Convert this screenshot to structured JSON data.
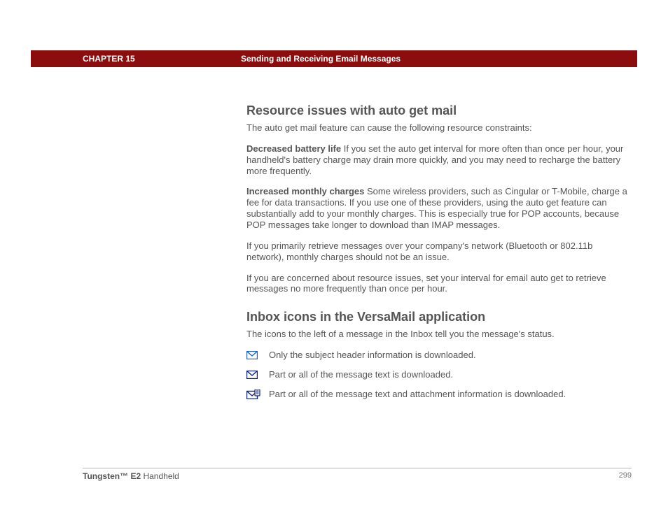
{
  "header": {
    "chapter": "CHAPTER 15",
    "title": "Sending and Receiving Email Messages"
  },
  "section1": {
    "heading": "Resource issues with auto get mail",
    "intro": "The auto get mail feature can cause the following resource constraints:",
    "p1_bold": "Decreased battery life",
    "p1_text": "   If you set the auto get interval for more often than once per hour, your handheld's battery charge may drain more quickly, and you may need to recharge the battery more frequently.",
    "p2_bold": "Increased monthly charges",
    "p2_text": "   Some wireless providers, such as Cingular or T-Mobile, charge a fee for data transactions. If you use one of these providers, using the auto get feature can substantially add to your monthly charges. This is especially true for POP accounts, because POP messages take longer to download than IMAP messages.",
    "p3": "If you primarily retrieve messages over your company's network (Bluetooth or 802.11b network), monthly charges should not be an issue.",
    "p4": "If you are concerned about resource issues, set your interval for email auto get to retrieve messages no more frequently than once per hour."
  },
  "section2": {
    "heading": "Inbox icons in the VersaMail application",
    "intro": "The icons to the left of a message in the Inbox tell you the message's status.",
    "rows": [
      {
        "label": "Only the subject header information is downloaded."
      },
      {
        "label": "Part or all of the message text is downloaded."
      },
      {
        "label": "Part or all of the message text and attachment information is downloaded."
      }
    ]
  },
  "footer": {
    "product_bold": "Tungsten™ E2",
    "product_rest": " Handheld",
    "page_number": "299"
  }
}
